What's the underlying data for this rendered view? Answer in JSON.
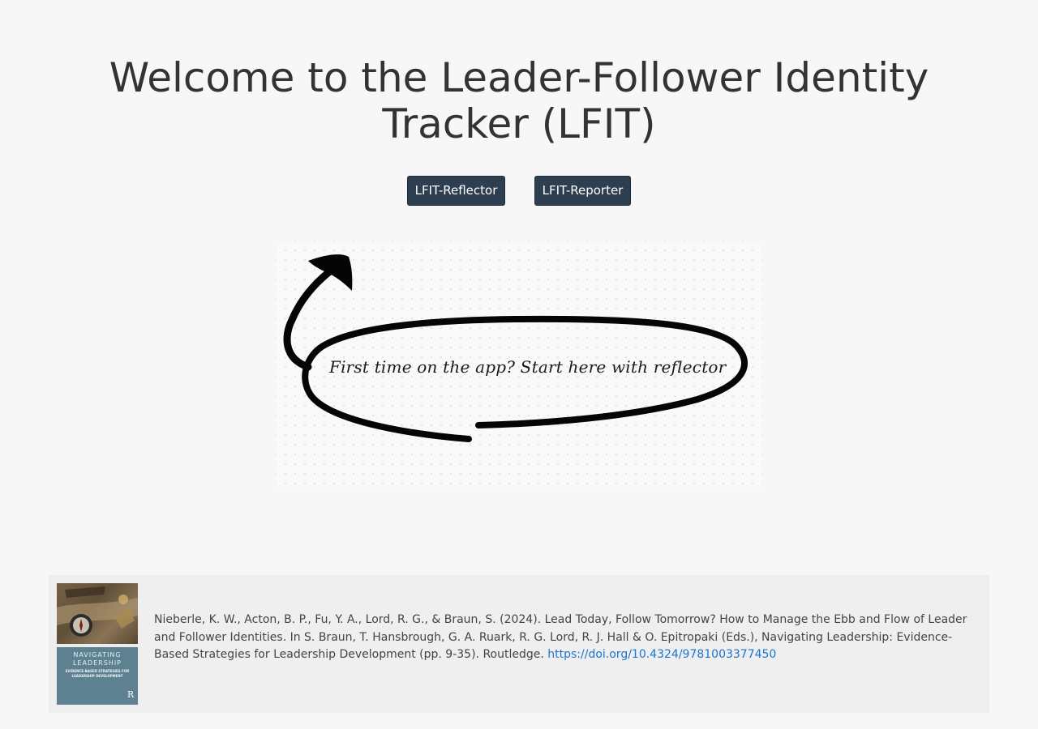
{
  "page": {
    "title": "Welcome to the Leader-Follower Identity Tracker (LFIT)"
  },
  "nav": {
    "reflector_label": "LFIT-Reflector",
    "reporter_label": "LFIT-Reporter"
  },
  "hint": {
    "text": "First time on the app? Start here with reflector"
  },
  "reference": {
    "book_cover": {
      "title": "NAVIGATING LEADERSHIP",
      "subtitle": "EVIDENCE-BASED STRATEGIES FOR LEADERSHIP DEVELOPMENT",
      "publisher_mark": "R"
    },
    "citation_text": "Nieberle, K. W., Acton, B. P., Fu, Y. A., Lord, R. G., & Braun, S. (2024). Lead Today, Follow Tomorrow? How to Manage the Ebb and Flow of Leader and Follower Identities. In S. Braun, T. Hansbrough, G. A. Ruark, R. G. Lord, R. J. Hall & O. Epitropaki (Eds.), Navigating Leadership: Evidence-Based Strategies for Leadership Development (pp. 9-35). Routledge.",
    "doi_link": "https://doi.org/10.4324/9781003377450"
  },
  "colors": {
    "button_bg": "#2c3e50",
    "link": "#1b74d1",
    "page_bg": "#f7f7f7"
  }
}
